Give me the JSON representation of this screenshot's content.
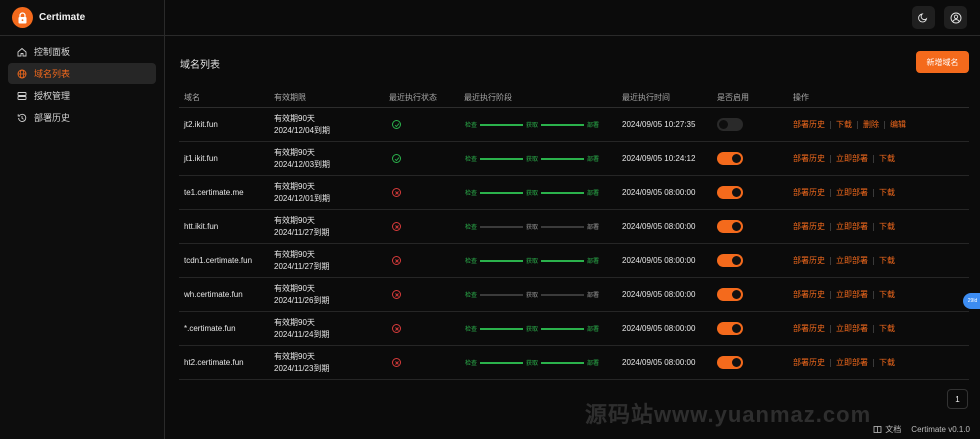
{
  "brand": {
    "name": "Certimate",
    "accent": "#f46a1c"
  },
  "sidebar": {
    "items": [
      {
        "label": "控制面板",
        "icon": "home-icon",
        "active": false
      },
      {
        "label": "域名列表",
        "icon": "globe-icon",
        "active": true
      },
      {
        "label": "授权管理",
        "icon": "server-icon",
        "active": false
      },
      {
        "label": "部署历史",
        "icon": "history-icon",
        "active": false
      }
    ]
  },
  "topbar": {
    "theme_icon": "moon-icon",
    "user_icon": "user-circle-icon"
  },
  "main": {
    "title": "域名列表",
    "add_button": "新增域名",
    "columns": [
      "域名",
      "有效期限",
      "最近执行状态",
      "最近执行阶段",
      "最近执行时间",
      "是否启用",
      "操作"
    ],
    "stage_labels": [
      "检查",
      "获取",
      "部署"
    ],
    "rows": [
      {
        "domain": "jt2.ikit.fun",
        "validity": "有效期90天",
        "expiry": "2024/12/04到期",
        "status": "success",
        "stages_done": 3,
        "time": "2024/09/05 10:27:35",
        "enabled": false,
        "actions": [
          "部署历史",
          "下载",
          "删除",
          "编辑"
        ]
      },
      {
        "domain": "jt1.ikit.fun",
        "validity": "有效期90天",
        "expiry": "2024/12/03到期",
        "status": "success",
        "stages_done": 3,
        "time": "2024/09/05 10:24:12",
        "enabled": true,
        "actions": [
          "部署历史",
          "立即部署",
          "下载"
        ]
      },
      {
        "domain": "te1.certimate.me",
        "validity": "有效期90天",
        "expiry": "2024/12/01到期",
        "status": "failed",
        "stages_done": 3,
        "time": "2024/09/05 08:00:00",
        "enabled": true,
        "actions": [
          "部署历史",
          "立即部署",
          "下载"
        ]
      },
      {
        "domain": "htt.ikit.fun",
        "validity": "有效期90天",
        "expiry": "2024/11/27到期",
        "status": "failed",
        "stages_done": 1,
        "time": "2024/09/05 08:00:00",
        "enabled": true,
        "actions": [
          "部署历史",
          "立即部署",
          "下载"
        ]
      },
      {
        "domain": "tcdn1.certimate.fun",
        "validity": "有效期90天",
        "expiry": "2024/11/27到期",
        "status": "failed",
        "stages_done": 3,
        "time": "2024/09/05 08:00:00",
        "enabled": true,
        "actions": [
          "部署历史",
          "立即部署",
          "下载"
        ]
      },
      {
        "domain": "wh.certimate.fun",
        "validity": "有效期90天",
        "expiry": "2024/11/26到期",
        "status": "failed",
        "stages_done": 1,
        "time": "2024/09/05 08:00:00",
        "enabled": true,
        "actions": [
          "部署历史",
          "立即部署",
          "下载"
        ]
      },
      {
        "domain": "*.certimate.fun",
        "validity": "有效期90天",
        "expiry": "2024/11/24到期",
        "status": "failed",
        "stages_done": 3,
        "time": "2024/09/05 08:00:00",
        "enabled": true,
        "actions": [
          "部署历史",
          "立即部署",
          "下载"
        ]
      },
      {
        "domain": "ht2.certimate.fun",
        "validity": "有效期90天",
        "expiry": "2024/11/23到期",
        "status": "failed",
        "stages_done": 3,
        "time": "2024/09/05 08:00:00",
        "enabled": true,
        "actions": [
          "部署历史",
          "立即部署",
          "下载"
        ]
      }
    ],
    "pagination": {
      "current": "1"
    }
  },
  "floating_badge": "29ld",
  "footer": {
    "docs": "文档",
    "version": "Certimate v0.1.0"
  },
  "watermark": "源码站www.yuanmaz.com",
  "colors": {
    "success": "#2bb24c",
    "failed": "#d83b3b",
    "pending": "#3b3b3b"
  }
}
